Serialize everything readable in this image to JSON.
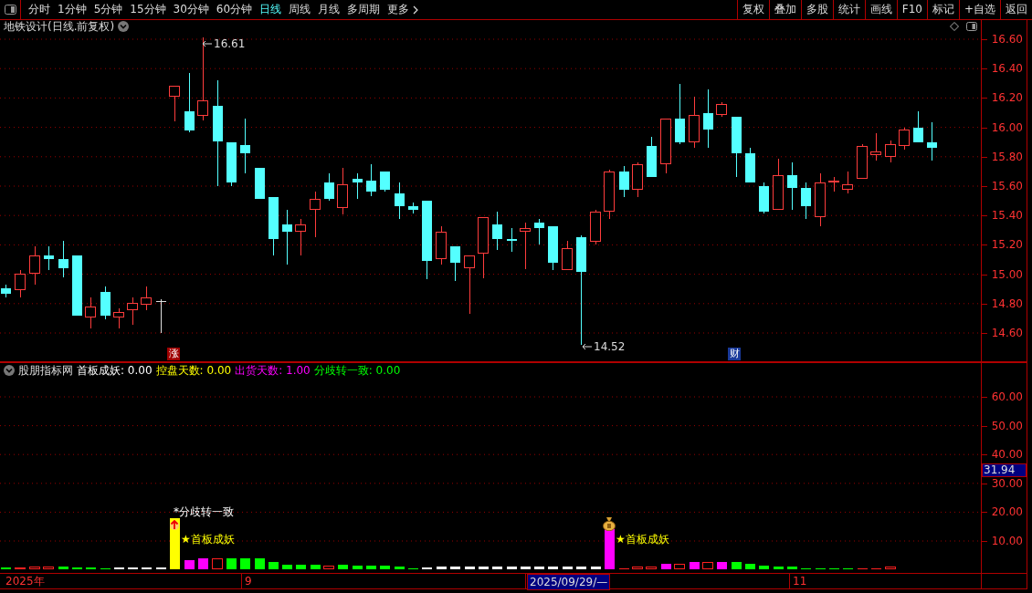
{
  "toolbar": {
    "periods": [
      {
        "label": "分时",
        "selected": false
      },
      {
        "label": "1分钟",
        "selected": false
      },
      {
        "label": "5分钟",
        "selected": false
      },
      {
        "label": "15分钟",
        "selected": false
      },
      {
        "label": "30分钟",
        "selected": false
      },
      {
        "label": "60分钟",
        "selected": false
      },
      {
        "label": "日线",
        "selected": true
      },
      {
        "label": "周线",
        "selected": false
      },
      {
        "label": "月线",
        "selected": false
      },
      {
        "label": "多周期",
        "selected": false
      }
    ],
    "more": "更多",
    "actions": [
      "复权",
      "叠加",
      "多股",
      "统计",
      "画线",
      "F10",
      "标记",
      "+自选",
      "返回"
    ]
  },
  "price_chart": {
    "title": "地铁设计(日线.前复权)",
    "axis_labels": [
      "16.60",
      "16.40",
      "16.20",
      "16.00",
      "15.80",
      "15.60",
      "15.40",
      "15.20",
      "15.00",
      "14.80",
      "14.60"
    ],
    "high_label": "16.61",
    "low_label": "14.52",
    "markers": [
      {
        "label": "涨",
        "color": "#a00000"
      },
      {
        "label": "财",
        "color": "#1a3a9a"
      }
    ]
  },
  "indicator": {
    "name": "股朋指标网",
    "values": [
      {
        "label": "首板成妖: 0.00",
        "color": "#ffffff"
      },
      {
        "label": "控盘天数: 0.00",
        "color": "#ffff00"
      },
      {
        "label": "出货天数: 1.00",
        "color": "#ff00ff"
      },
      {
        "label": "分歧转一致: 0.00",
        "color": "#00ff00"
      }
    ],
    "axis_labels": [
      "60.00",
      "50.00",
      "40.00",
      "30.00",
      "20.00",
      "10.00"
    ],
    "current_value": "31.94",
    "annotations": [
      "*分歧转一致",
      "★首板成妖",
      "★首板成妖"
    ]
  },
  "date_axis": [
    {
      "label": "2025年",
      "selected": false
    },
    {
      "label": "9",
      "selected": false
    },
    {
      "label": "2025/09/29/—",
      "selected": true
    },
    {
      "label": "11",
      "selected": false
    }
  ]
}
